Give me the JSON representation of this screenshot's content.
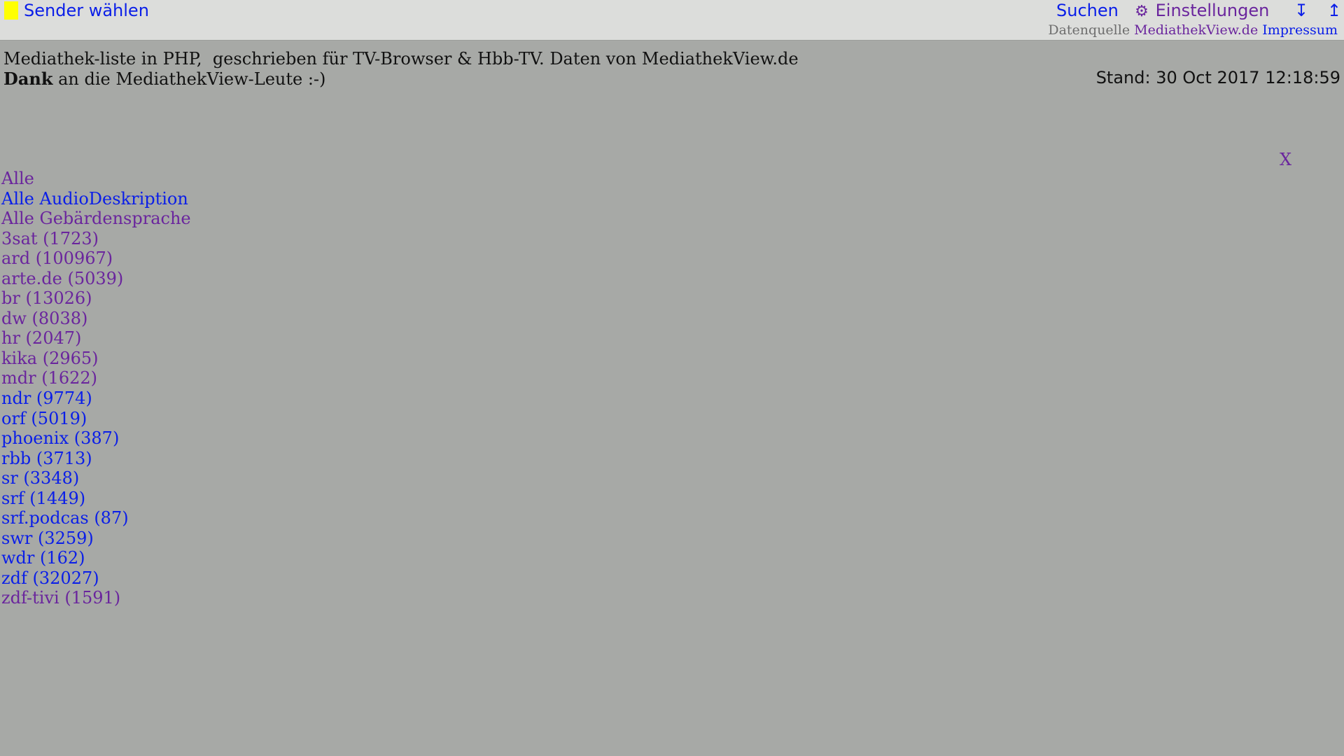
{
  "topbar": {
    "sender_label": "Sender wählen",
    "search_label": "Suchen",
    "settings_label": "Einstellungen",
    "gear_icon": "⚙",
    "arrow_bottom_icon": "↧",
    "arrow_top_icon": "↥",
    "source_label": "Datenquelle",
    "source_link": "MediathekView.de",
    "impressum_link": "Impressum",
    "highlight_color": "#ffff00"
  },
  "intro": {
    "line1": "Mediathek-liste in PHP,  geschrieben für TV-Browser & Hbb-TV. Daten von MediathekView.de",
    "line2_bold": "Dank",
    "line2_rest": " an die MediathekView-Leute :-)",
    "stand": "Stand: 30 Oct 2017 12:18:59"
  },
  "close_label": "X",
  "channels": [
    {
      "label": "Alle",
      "visited": true
    },
    {
      "label": "Alle AudioDeskription",
      "visited": false
    },
    {
      "label": "Alle Gebärdensprache",
      "visited": true
    },
    {
      "label": "3sat (1723)",
      "visited": true
    },
    {
      "label": "ard (100967)",
      "visited": true
    },
    {
      "label": "arte.de (5039)",
      "visited": true
    },
    {
      "label": "br (13026)",
      "visited": true
    },
    {
      "label": "dw (8038)",
      "visited": true
    },
    {
      "label": "hr (2047)",
      "visited": true
    },
    {
      "label": "kika (2965)",
      "visited": true
    },
    {
      "label": "mdr (1622)",
      "visited": true
    },
    {
      "label": "ndr (9774)",
      "visited": false
    },
    {
      "label": "orf (5019)",
      "visited": false
    },
    {
      "label": "phoenix (387)",
      "visited": false
    },
    {
      "label": "rbb (3713)",
      "visited": false
    },
    {
      "label": "sr (3348)",
      "visited": false
    },
    {
      "label": "srf (1449)",
      "visited": false
    },
    {
      "label": "srf.podcas (87)",
      "visited": false
    },
    {
      "label": "swr (3259)",
      "visited": false
    },
    {
      "label": "wdr (162)",
      "visited": false
    },
    {
      "label": "zdf (32027)",
      "visited": false
    },
    {
      "label": "zdf-tivi (1591)",
      "visited": true
    }
  ],
  "colors": {
    "background": "#a7a9a6",
    "topbar": "#dcdddb",
    "link": "#0a1ee8",
    "visited_link": "#6a259d"
  }
}
